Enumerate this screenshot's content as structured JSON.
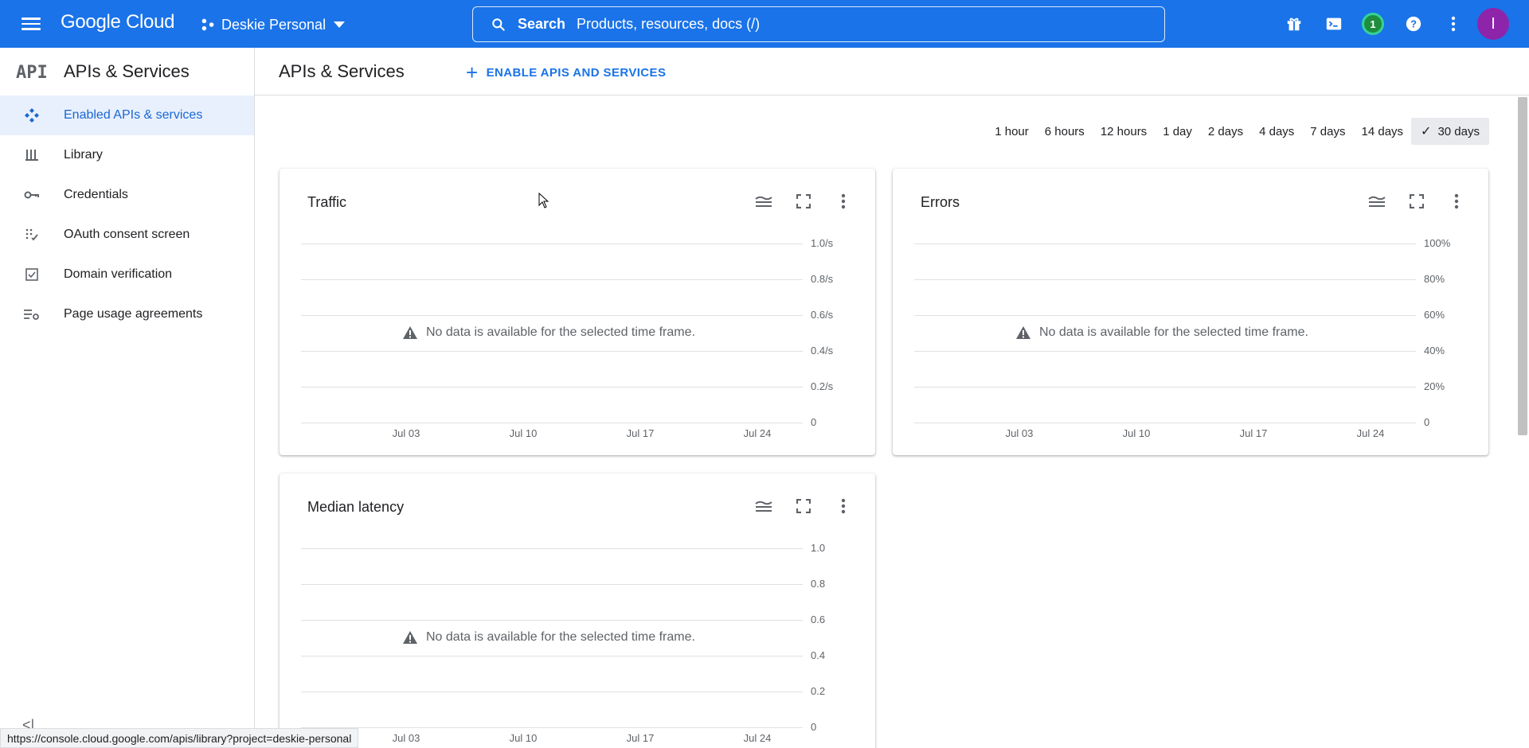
{
  "topbar": {
    "logo_text": "Google Cloud",
    "project_name": "Deskie Personal",
    "search_label": "Search",
    "search_placeholder": "Products, resources, docs (/)",
    "notification_count": "1",
    "avatar_initial": "I",
    "bar_color": "#1a73e8"
  },
  "sidebar": {
    "logo_text": "API",
    "title": "APIs & Services",
    "items": [
      {
        "label": "Enabled APIs & services",
        "icon": "enabled-apis-icon",
        "active": true
      },
      {
        "label": "Library",
        "icon": "library-icon",
        "active": false
      },
      {
        "label": "Credentials",
        "icon": "key-icon",
        "active": false
      },
      {
        "label": "OAuth consent screen",
        "icon": "oauth-icon",
        "active": false
      },
      {
        "label": "Domain verification",
        "icon": "checkbox-icon",
        "active": false
      },
      {
        "label": "Page usage agreements",
        "icon": "settings-list-icon",
        "active": false
      }
    ],
    "collapse_glyph": "<|"
  },
  "main": {
    "title": "APIs & Services",
    "enable_button": "ENABLE APIS AND SERVICES",
    "time_ranges": [
      "1 hour",
      "6 hours",
      "12 hours",
      "1 day",
      "2 days",
      "4 days",
      "7 days",
      "14 days",
      "30 days"
    ],
    "selected_range": "30 days"
  },
  "charts": [
    {
      "title": "Traffic",
      "no_data": "No data is available for the selected time frame.",
      "y_ticks": [
        "1.0/s",
        "0.8/s",
        "0.6/s",
        "0.4/s",
        "0.2/s",
        "0"
      ],
      "x_ticks": [
        "Jul 03",
        "Jul 10",
        "Jul 17",
        "Jul 24"
      ]
    },
    {
      "title": "Errors",
      "no_data": "No data is available for the selected time frame.",
      "y_ticks": [
        "100%",
        "80%",
        "60%",
        "40%",
        "20%",
        "0"
      ],
      "x_ticks": [
        "Jul 03",
        "Jul 10",
        "Jul 17",
        "Jul 24"
      ]
    },
    {
      "title": "Median latency",
      "no_data": "No data is available for the selected time frame.",
      "y_ticks": [
        "1.0",
        "0.8",
        "0.6",
        "0.4",
        "0.2",
        "0"
      ],
      "x_ticks": [
        "Jul 03",
        "Jul 10",
        "Jul 17",
        "Jul 24"
      ]
    }
  ],
  "chart_data": [
    {
      "type": "line",
      "title": "Traffic",
      "categories": [
        "Jul 03",
        "Jul 10",
        "Jul 17",
        "Jul 24"
      ],
      "series": [],
      "ylim": [
        0,
        1.0
      ],
      "grid": true
    },
    {
      "type": "line",
      "title": "Errors",
      "categories": [
        "Jul 03",
        "Jul 10",
        "Jul 17",
        "Jul 24"
      ],
      "series": [],
      "ylim": [
        0,
        100
      ],
      "grid": true
    },
    {
      "type": "line",
      "title": "Median latency",
      "categories": [
        "Jul 03",
        "Jul 10",
        "Jul 17",
        "Jul 24"
      ],
      "series": [],
      "ylim": [
        0,
        1.0
      ],
      "grid": true
    }
  ],
  "status_url": "https://console.cloud.google.com/apis/library?project=deskie-personal"
}
